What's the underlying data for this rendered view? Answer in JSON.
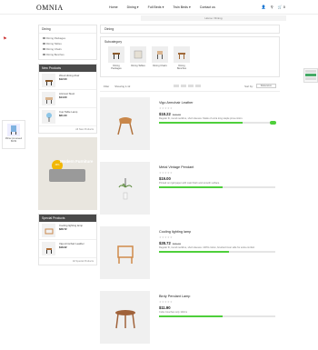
{
  "header": {
    "logo": "OMNIA",
    "nav": [
      "Home",
      "Dining ▾",
      "Full Beds ▾",
      "Twin Beds ▾",
      "Contact us"
    ],
    "icons": [
      "user-icon",
      "search-icon",
      "cart-icon"
    ],
    "cart_count": "0"
  },
  "breadcrumb": "Home  /  Dining",
  "sidebar": {
    "category_title": "Dining",
    "categories": [
      "Dining Packages",
      "Dining Tables",
      "Dining Chairs",
      "Dining Benches"
    ],
    "new_products_title": "New Products",
    "new_products": [
      {
        "name": "Wood dining chair",
        "price": "$12.00"
      },
      {
        "name": "Armrest Stool",
        "price": "$14.00"
      },
      {
        "name": "Cup Table Lamp",
        "price": "$21.00"
      }
    ],
    "all_new_label": "All New Products",
    "banner": {
      "badge": "30%",
      "title": "Modern Furniture",
      "subtitle": "Sale up to 30%"
    },
    "specials_title": "Special Products",
    "specials": [
      {
        "name": "Cooling lighting lamp",
        "price": "$28.72"
      },
      {
        "name": "Vigo Armchair Leather",
        "price": "$18.22"
      }
    ],
    "all_specials_label": "All Special Products"
  },
  "main": {
    "title": "Dining",
    "subcategory_title": "Subcategory",
    "subcategories": [
      "Dining Packages",
      "Dining Tables",
      "Dining Chairs",
      "Dining Benches"
    ],
    "toolbar": {
      "filter": "Filter",
      "products_count": "Showing 1-12",
      "sort_label": "Sort by:",
      "sort_value": "Relevance"
    },
    "items": [
      {
        "name": "Vigo Armchair Leather",
        "price": "$18.22",
        "old_price": "$19.99",
        "desc": "Regular fit, round neckline, short sleeves. Made of extra long staple pima cotton.",
        "stock": 0.72
      },
      {
        "name": "Metal Vintage Pendant",
        "price": "$19.00",
        "old_price": "",
        "desc": "Printed on rigid paper with matt finish and smooth surface.",
        "stock": 0.55
      },
      {
        "name": "Cooling lighting lamp",
        "price": "$28.72",
        "old_price": "$35.90",
        "desc": "Regular fit, round neckline, short sleeves. 100% cotton, brushed inner side for extra comfort.",
        "stock": 0.6
      },
      {
        "name": "Birdy Pendant Lamp",
        "price": "$11.90",
        "old_price": "",
        "desc": "Cube Couches only 120cm",
        "stock": 0.55
      }
    ]
  },
  "popup": {
    "label": "Mirrac previewed",
    "price": "$9.99"
  },
  "colors": {
    "accent": "#4ecf3b",
    "dark": "#4a4a4a"
  }
}
